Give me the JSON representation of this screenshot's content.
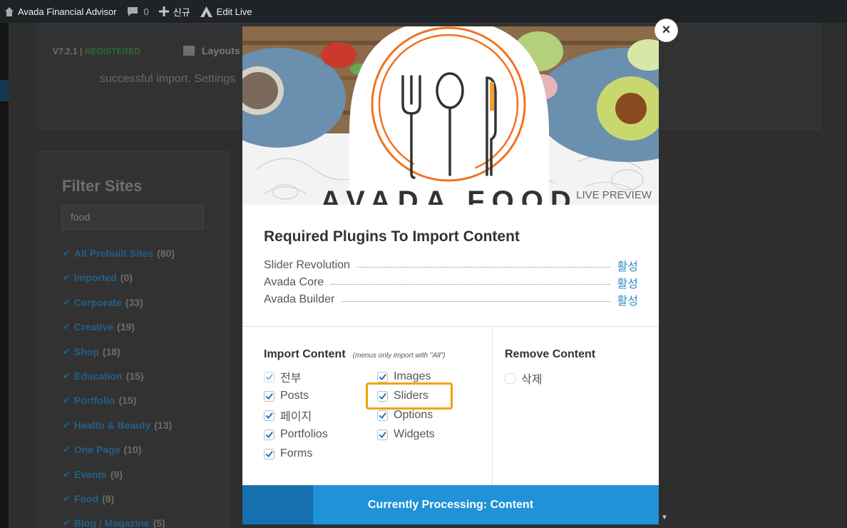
{
  "admin_bar": {
    "site_name": "Avada Financial Advisor",
    "comments_count": "0",
    "new_label": "신규",
    "edit_live_label": "Edit Live"
  },
  "background": {
    "version": "V7.2.1",
    "separator": "|",
    "registered": "REGISTERED",
    "layouts_label": "Layouts",
    "success_text": "successful import. Settings",
    "filter_title": "Filter Sites",
    "filter_value": "food",
    "categories": [
      {
        "name": "All Prebuilt Sites",
        "count": "(80)"
      },
      {
        "name": "Imported",
        "count": "(0)"
      },
      {
        "name": "Corporate",
        "count": "(33)"
      },
      {
        "name": "Creative",
        "count": "(19)"
      },
      {
        "name": "Shop",
        "count": "(18)"
      },
      {
        "name": "Education",
        "count": "(15)"
      },
      {
        "name": "Portfolio",
        "count": "(15)"
      },
      {
        "name": "Health & Beauty",
        "count": "(13)"
      },
      {
        "name": "One Page",
        "count": "(10)"
      },
      {
        "name": "Events",
        "count": "(9)"
      },
      {
        "name": "Food",
        "count": "(8)"
      },
      {
        "name": "Blog / Magazine",
        "count": "(5)"
      }
    ]
  },
  "modal": {
    "close_label": "×",
    "live_preview": "LIVE PREVIEW",
    "required_title": "Required Plugins To Import Content",
    "plugins": [
      {
        "name": "Slider Revolution",
        "action": "활성"
      },
      {
        "name": "Avada Core",
        "action": "활성"
      },
      {
        "name": "Avada Builder",
        "action": "활성"
      }
    ],
    "import_title": "Import Content",
    "import_note": "(menus only import with \"All\")",
    "import_options_left": [
      {
        "label": "전부",
        "checked": true
      },
      {
        "label": "Posts",
        "checked": true
      },
      {
        "label": "페이지",
        "checked": true
      },
      {
        "label": "Portfolios",
        "checked": true
      },
      {
        "label": "Forms",
        "checked": true
      }
    ],
    "import_options_right": [
      {
        "label": "Images",
        "checked": true
      },
      {
        "label": "Sliders",
        "checked": true
      },
      {
        "label": "Options",
        "checked": true
      },
      {
        "label": "Widgets",
        "checked": true
      }
    ],
    "remove_title": "Remove Content",
    "remove_option": {
      "label": "삭제",
      "checked": false
    },
    "progress_text": "Currently Processing: Content",
    "progress_fraction": 0.17
  },
  "colors": {
    "accent": "#1f92d8",
    "accent_dark": "#156fb0",
    "highlight": "#f0a30a",
    "link": "#2a8bc4",
    "logo_orange": "#f0731f"
  }
}
